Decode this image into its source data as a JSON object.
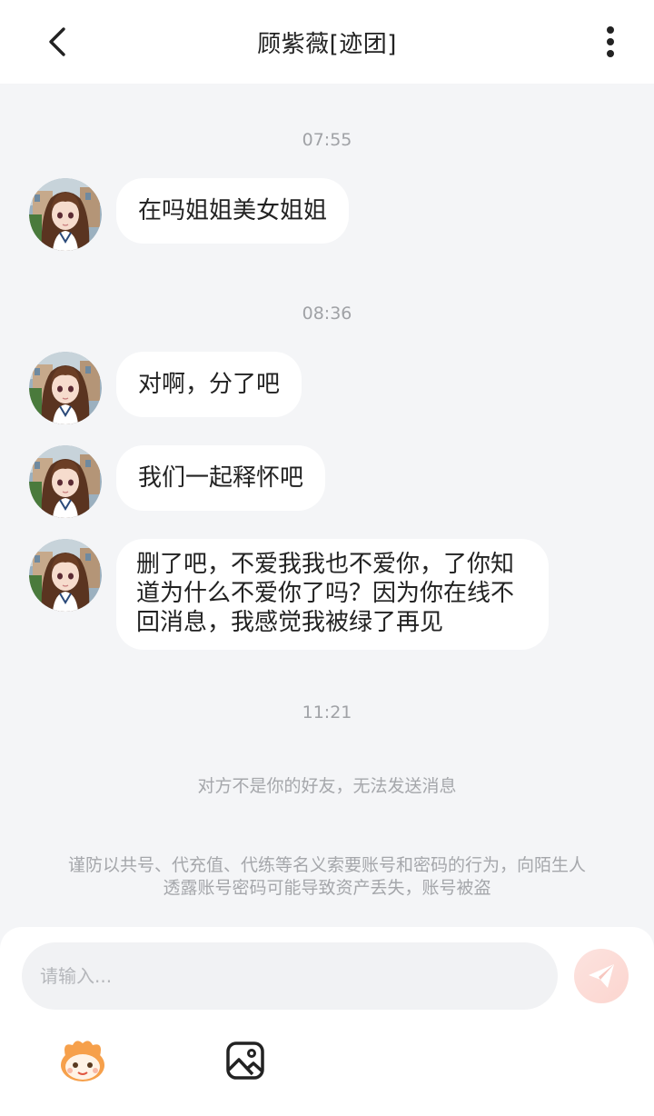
{
  "header": {
    "title": "顾紫薇[迹团]",
    "back_icon": "chevron-left-icon",
    "more_icon": "more-vertical-icon"
  },
  "messages": [
    {
      "time": "07:55"
    },
    {
      "text": "在吗姐姐美女姐姐"
    },
    {
      "time": "08:36"
    },
    {
      "text": "对啊，分了吧"
    },
    {
      "text": "我们一起释怀吧"
    },
    {
      "lines": [
        "删了吧，不爱我我也不爱你，了你知",
        "道为什么不爱你了吗？因为你在线不",
        "回消息，我感觉我被绿了再见"
      ]
    },
    {
      "time": "11:21"
    }
  ],
  "system_notice": "对方不是你的好友，无法发送消息",
  "warning": {
    "line1": "谨防以共号、代充值、代练等名义索要账号和密码的行为，向陌生人",
    "line2": "透露账号密码可能导致资产丢失，账号被盗"
  },
  "input": {
    "placeholder": "请输入...",
    "value": ""
  },
  "toolbar": {
    "send_icon": "paper-plane-icon",
    "emoji_icon": "mascot-emoji-icon",
    "image_icon": "image-icon"
  },
  "colors": {
    "background": "#f4f5f7",
    "bubble": "#ffffff",
    "send_button": "#fbd5cf",
    "emoji_accent": "#f6a04b"
  }
}
